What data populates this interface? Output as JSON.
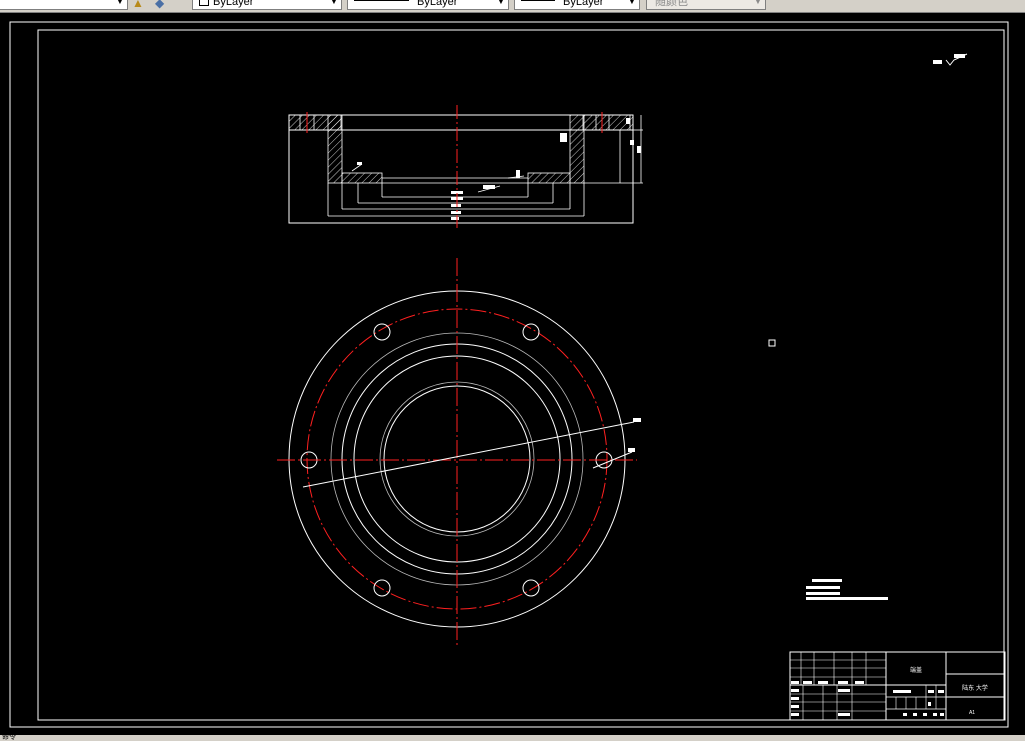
{
  "toolbar": {
    "color_label": "ByLayer",
    "linetype_label": "ByLayer",
    "lineweight_label": "ByLayer",
    "plotstyle_label": "随颜色"
  },
  "titleblock": {
    "part_name": "端盖",
    "company": "陆东 大学",
    "sheet_size": "A1"
  },
  "status": {
    "coord_stub": "命令"
  }
}
